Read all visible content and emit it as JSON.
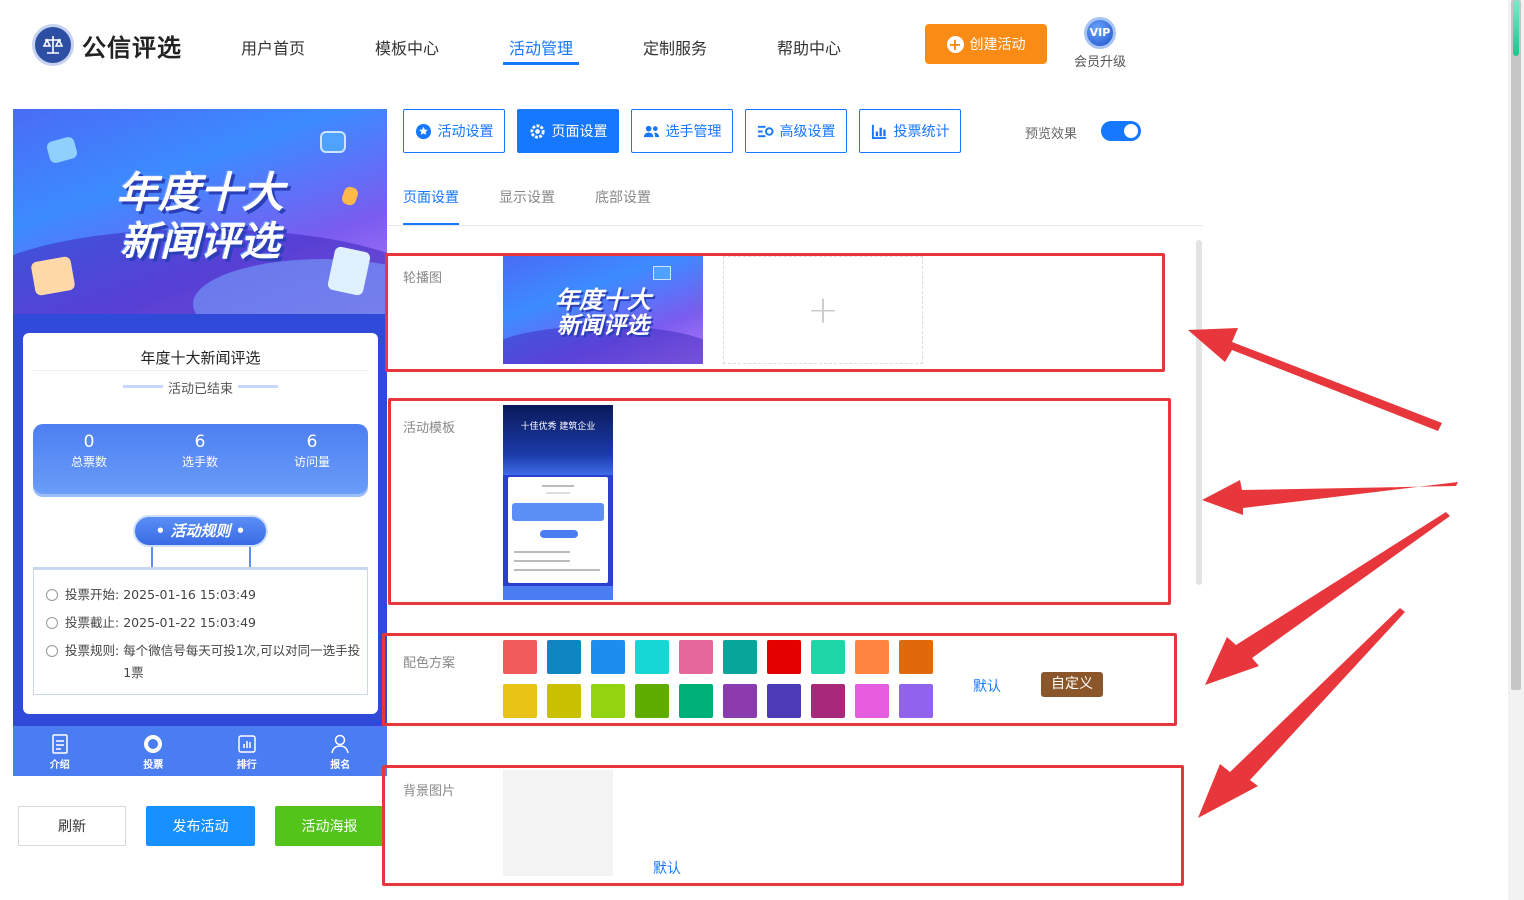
{
  "header": {
    "logo_text": "公信评选",
    "nav": [
      {
        "label": "用户首页",
        "active": false
      },
      {
        "label": "模板中心",
        "active": false
      },
      {
        "label": "活动管理",
        "active": true
      },
      {
        "label": "定制服务",
        "active": false
      },
      {
        "label": "帮助中心",
        "active": false
      }
    ],
    "create_button": "创建活动",
    "vip_badge": "VIP",
    "vip_label": "会员升级"
  },
  "preview": {
    "banner_line1": "年度十大",
    "banner_line2": "新闻评选",
    "card_title": "年度十大新闻评选",
    "status": "活动已结束",
    "stats": [
      {
        "value": "0",
        "label": "总票数"
      },
      {
        "value": "6",
        "label": "选手数"
      },
      {
        "value": "6",
        "label": "访问量"
      }
    ],
    "rules_button": "活动规则",
    "rules": {
      "start_label": "投票开始:",
      "start_value": "2025-01-16 15:03:49",
      "end_label": "投票截止:",
      "end_value": "2025-01-22 15:03:49",
      "rule_label": "投票规则:",
      "rule_value": "每个微信号每天可投1次,可以对同一选手投1票"
    },
    "bottom_nav": [
      {
        "label": "介绍",
        "icon": "document-icon"
      },
      {
        "label": "投票",
        "icon": "vote-icon"
      },
      {
        "label": "排行",
        "icon": "chart-icon"
      },
      {
        "label": "报名",
        "icon": "user-icon"
      }
    ]
  },
  "left_actions": {
    "refresh": "刷新",
    "publish": "发布活动",
    "poster": "活动海报"
  },
  "toolbar": {
    "buttons": [
      {
        "label": "活动设置",
        "icon": "star-icon",
        "active": false
      },
      {
        "label": "页面设置",
        "icon": "gear-icon",
        "active": true
      },
      {
        "label": "选手管理",
        "icon": "users-icon",
        "active": false
      },
      {
        "label": "高级设置",
        "icon": "settings-sliders-icon",
        "active": false
      },
      {
        "label": "投票统计",
        "icon": "bar-chart-icon",
        "active": false
      }
    ],
    "preview_label": "预览效果",
    "preview_enabled": true
  },
  "subtabs": [
    {
      "label": "页面设置",
      "active": true
    },
    {
      "label": "显示设置",
      "active": false
    },
    {
      "label": "底部设置",
      "active": false
    }
  ],
  "sections": {
    "carousel": {
      "label": "轮播图",
      "image_line1": "年度十大",
      "image_line2": "新闻评选"
    },
    "template": {
      "label": "活动模板",
      "thumb_title": "十佳优秀 建筑企业"
    },
    "colors": {
      "label": "配色方案",
      "row1": [
        "#f15b5b",
        "#0e86c2",
        "#1d8ef0",
        "#17d6d6",
        "#e5689a",
        "#08a59a",
        "#e50000",
        "#1ed6a8",
        "#ff8540",
        "#e0690a"
      ],
      "row2": [
        "#e9c416",
        "#c9c000",
        "#92d40f",
        "#5fad00",
        "#00b177",
        "#8b3bad",
        "#4c3bb7",
        "#a8287a",
        "#e55cde",
        "#9163ec"
      ],
      "default_label": "默认",
      "custom_label": "自定义"
    },
    "background": {
      "label": "背景图片",
      "default_label": "默认"
    }
  },
  "colors": {
    "primary": "#1677ff",
    "create_button": "#fa8c16",
    "publish_button": "#1890ff",
    "poster_button": "#52c41a",
    "annotation_red": "#e8373c"
  }
}
